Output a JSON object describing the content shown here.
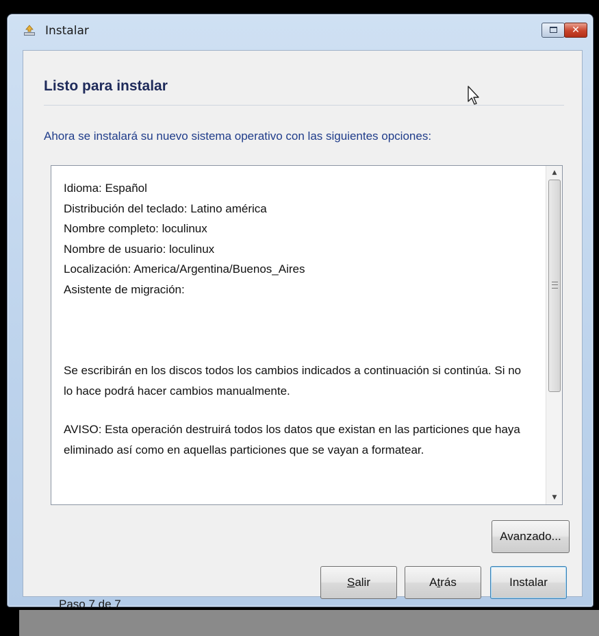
{
  "window": {
    "title": "Instalar"
  },
  "page": {
    "heading": "Listo para instalar",
    "intro": "Ahora se instalará su nuevo sistema operativo con las siguientes opciones:"
  },
  "summary": {
    "lines": [
      "Idioma: Español",
      "Distribución del teclado: Latino américa",
      "Nombre completo: loculinux",
      "Nombre de usuario: loculinux",
      "Localización: America/Argentina/Buenos_Aires",
      "Asistente de migración:"
    ],
    "paragraph1": "Se escribirán en los discos todos los cambios indicados a continuación si continúa. Si no lo hace podrá hacer cambios manualmente.",
    "paragraph2": "AVISO: Esta operación destruirá todos los datos que existan en las particiones que haya eliminado así como en aquellas particiones que se vayan a formatear."
  },
  "buttons": {
    "advanced": "Avanzado...",
    "exit_mnemonic": "S",
    "exit_rest": "alir",
    "back_pre": "A",
    "back_mnemonic": "t",
    "back_rest": "rás",
    "install": "Instalar"
  },
  "footer": {
    "step": "Paso 7 de 7"
  },
  "icons": {
    "app": "installer-icon",
    "maximize": "maximize-icon",
    "close": "close-icon",
    "cursor": "mouse-pointer-icon"
  }
}
